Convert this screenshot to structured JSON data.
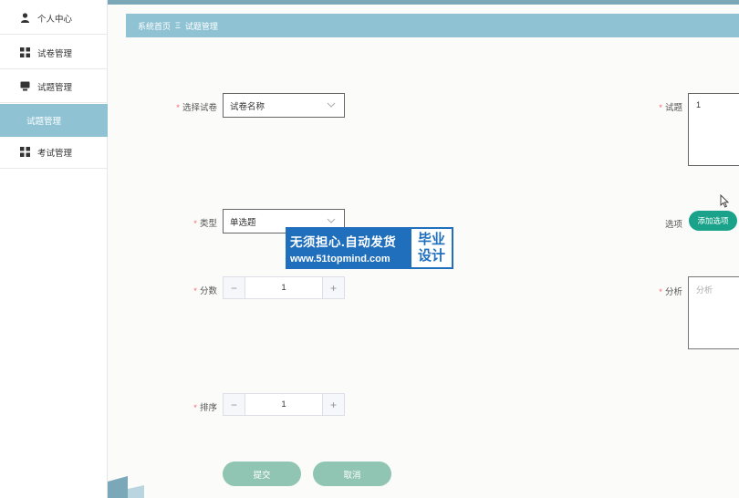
{
  "sidebar": {
    "items": [
      {
        "label": "个人中心",
        "icon": "user-icon"
      },
      {
        "label": "试卷管理",
        "icon": "grid-icon"
      },
      {
        "label": "试题管理",
        "icon": "monitor-icon"
      },
      {
        "label": "试题管理",
        "icon": ""
      },
      {
        "label": "考试管理",
        "icon": "grid-icon"
      }
    ]
  },
  "breadcrumb": {
    "home": "系统首页",
    "separator": "Ξ",
    "current": "试题管理"
  },
  "form": {
    "paper": {
      "label": "选择试卷",
      "value": "试卷名称"
    },
    "type": {
      "label": "类型",
      "value": "单选题"
    },
    "score": {
      "label": "分数",
      "value": "1"
    },
    "order": {
      "label": "排序",
      "value": "1"
    },
    "question": {
      "label": "试题",
      "value": "1"
    },
    "options": {
      "label": "选项",
      "button": "添加选项"
    },
    "analysis": {
      "label": "分析",
      "placeholder": "分析"
    },
    "required_mark": "*"
  },
  "actions": {
    "submit": "提交",
    "cancel": "取消"
  },
  "watermark": {
    "line1": "无须担心.自动发货",
    "line2": "www.51topmind.com",
    "right1": "毕业",
    "right2": "设计"
  },
  "colors": {
    "accent": "#8fc3d4",
    "add_button": "#1aa38a",
    "action_button": "#8fc5b2",
    "watermark": "#1f6fbd"
  }
}
